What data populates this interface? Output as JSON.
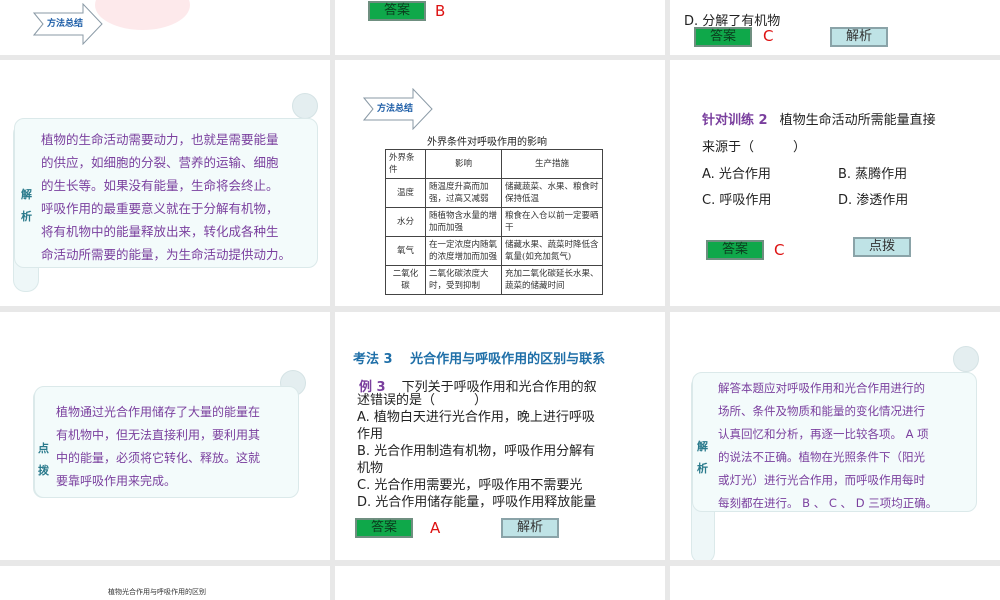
{
  "common": {
    "answer_label": "答案",
    "analysis_label": "解析",
    "hint_label": "点拨",
    "method_label": "方法总结"
  },
  "slide_r0c1": {
    "answer": "B"
  },
  "slide_r0c2": {
    "option_d": "D. 分解了有机物",
    "answer": "C"
  },
  "slide_r1c0": {
    "side_label": [
      "解",
      "析"
    ],
    "lines": [
      "植物的生命活动需要动力，也就是需要能量",
      "的供应，如细胞的分裂、营养的运输、细胞",
      "的生长等。如果没有能量，生命将会终止。",
      "呼吸作用的最重要意义就在于分解有机物，",
      "将有机物中的能量释放出来，转化成各种生",
      "命活动所需要的能量，为生命活动提供动力。"
    ]
  },
  "slide_r1c1": {
    "table_title": "外界条件对呼吸作用的影响",
    "headers": [
      "外界条件",
      "影响",
      "生产措施"
    ],
    "rows": [
      [
        "温度",
        "随温度升高而加强，过高又减弱",
        "储藏蔬菜、水果、粮食时保持低温"
      ],
      [
        "水分",
        "随植物含水量的增加而加强",
        "粮食在入仓以前一定要晒干"
      ],
      [
        "氧气",
        "在一定浓度内随氧的浓度增加而加强",
        "储藏水果、蔬菜时降低含氧量(如充加氮气)"
      ],
      [
        "二氧化碳",
        "二氧化碳浓度大时，受到抑制",
        "充加二氧化碳延长水果、蔬菜的储藏时间"
      ]
    ]
  },
  "slide_r1c2": {
    "title": "针对训练 2",
    "question": "植物生命活动所需能量直接",
    "question2": "来源于（　　　）",
    "options": [
      "A. 光合作用",
      "B. 蒸腾作用",
      "C. 呼吸作用",
      "D. 渗透作用"
    ],
    "answer": "C"
  },
  "slide_r2c0": {
    "side_label": [
      "点",
      "拨"
    ],
    "lines": [
      "植物通过光合作用储存了大量的能量在",
      "有机物中，但无法直接利用，要利用其",
      "中的能量，必须将它转化、释放。这就",
      "要靠呼吸作用来完成。"
    ]
  },
  "slide_r2c1": {
    "heading": "考法 3　 光合作用与呼吸作用的区别与联系",
    "example": "例 3",
    "question": "下列关于呼吸作用和光合作用的叙",
    "question2": "述错误的是（　　　）",
    "options": [
      "A. 植物白天进行光合作用，晚上进行呼吸",
      "作用",
      "B. 光合作用制造有机物，呼吸作用分解有",
      "机物",
      "C. 光合作用需要光，呼吸作用不需要光",
      "D. 光合作用储存能量，呼吸作用释放能量"
    ],
    "answer": "A"
  },
  "slide_r2c2": {
    "side_label": [
      "解",
      "析"
    ],
    "lines": [
      "解答本题应对呼吸作用和光合作用进行的",
      "场所、条件及物质和能量的变化情况进行",
      "认真回忆和分析，再逐一比较各项。 A 项",
      "的说法不正确。植物在光照条件下（阳光",
      "或灯光）进行光合作用，而呼吸作用每时",
      "每刻都在进行。 B 、 C 、 D 三项均正确。"
    ]
  },
  "slide_r3c0": {
    "caption": "植物光合作用与呼吸作用的区别"
  }
}
